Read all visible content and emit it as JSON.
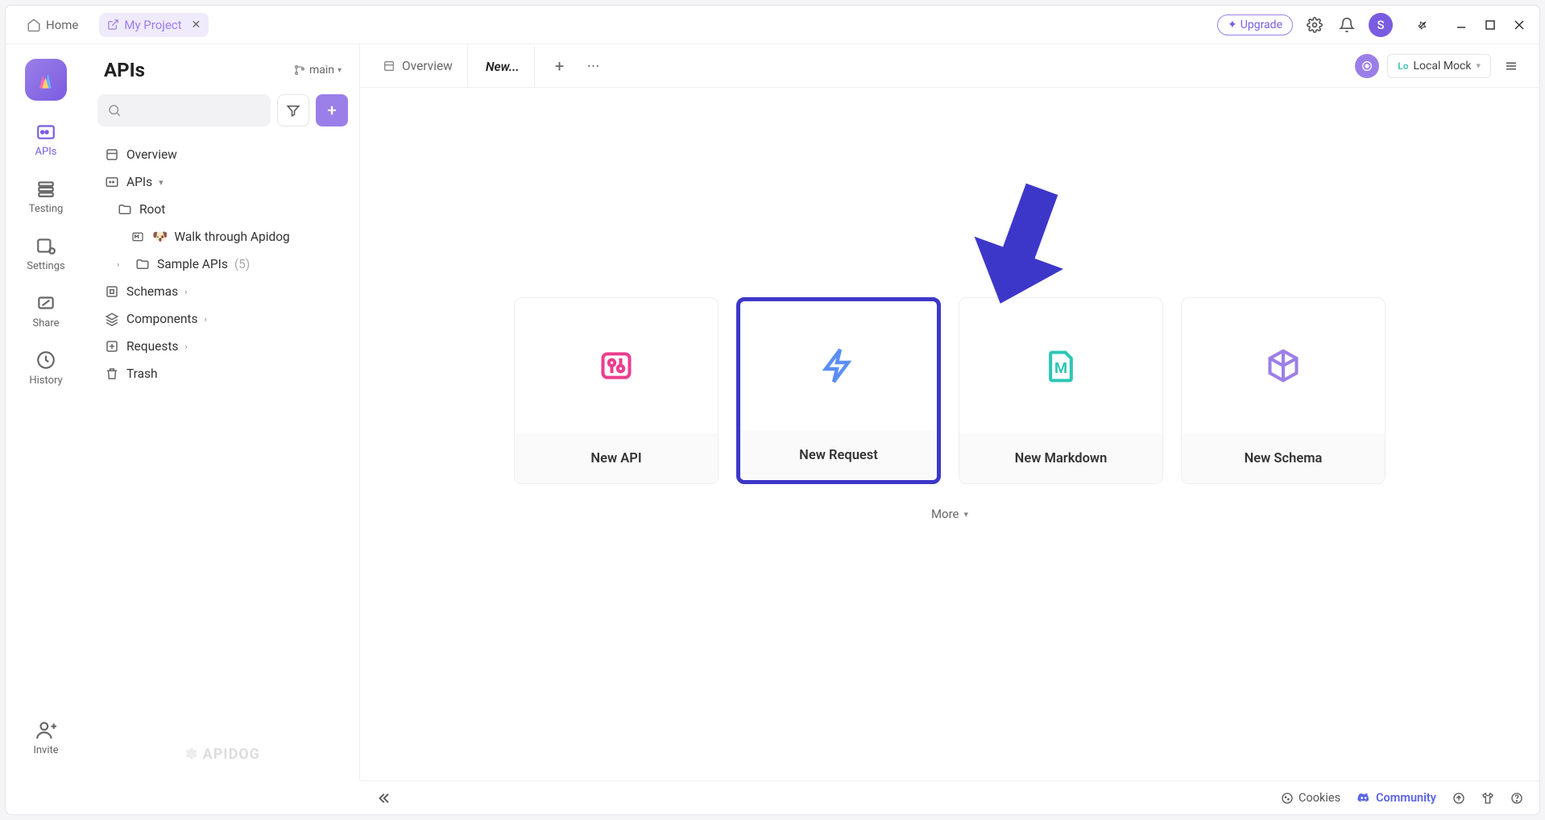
{
  "titlebar": {
    "home": "Home",
    "project_tab": "My Project",
    "upgrade": "Upgrade",
    "avatar_initial": "S"
  },
  "rail": {
    "items": [
      {
        "label": "APIs"
      },
      {
        "label": "Testing"
      },
      {
        "label": "Settings"
      },
      {
        "label": "Share"
      },
      {
        "label": "History"
      }
    ],
    "invite": "Invite"
  },
  "sidebar": {
    "title": "APIs",
    "branch": "main",
    "tree": {
      "overview": "Overview",
      "apis": "APIs",
      "root": "Root",
      "walkthrough": "Walk through Apidog",
      "sample_apis": "Sample APIs",
      "sample_apis_count": "(5)",
      "schemas": "Schemas",
      "components": "Components",
      "requests": "Requests",
      "trash": "Trash"
    },
    "brand": "APIDOG"
  },
  "main": {
    "tabs": {
      "overview": "Overview",
      "new": "New..."
    },
    "env": {
      "prefix": "Lo",
      "label": "Local Mock"
    },
    "cards": [
      {
        "label": "New API"
      },
      {
        "label": "New Request"
      },
      {
        "label": "New Markdown"
      },
      {
        "label": "New Schema"
      }
    ],
    "more": "More"
  },
  "footer": {
    "cookies": "Cookies",
    "community": "Community"
  }
}
